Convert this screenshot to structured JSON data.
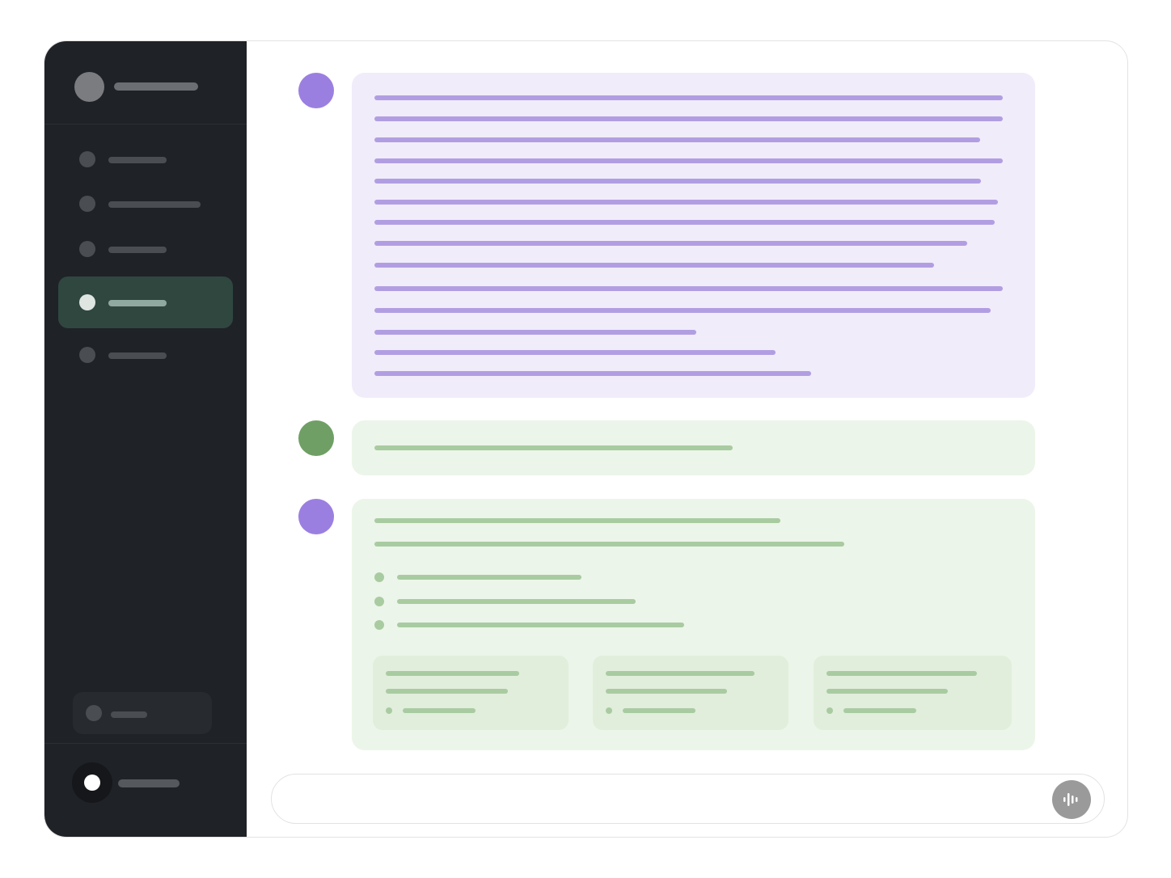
{
  "colors": {
    "sidebar_bg": "#1f2227",
    "active_item_bg": "#304740",
    "assistant_avatar": "#9b7fe0",
    "user_avatar": "#6f9f65",
    "assistant_bubble": "#f1ecfa",
    "user_bubble": "#ecf5e9"
  },
  "sidebar": {
    "items": [
      {
        "state": "default"
      },
      {
        "state": "default"
      },
      {
        "state": "default"
      },
      {
        "state": "active"
      },
      {
        "state": "default"
      }
    ]
  },
  "composer": {
    "placeholder": "",
    "voice_icon": "voice-waveform-icon"
  }
}
